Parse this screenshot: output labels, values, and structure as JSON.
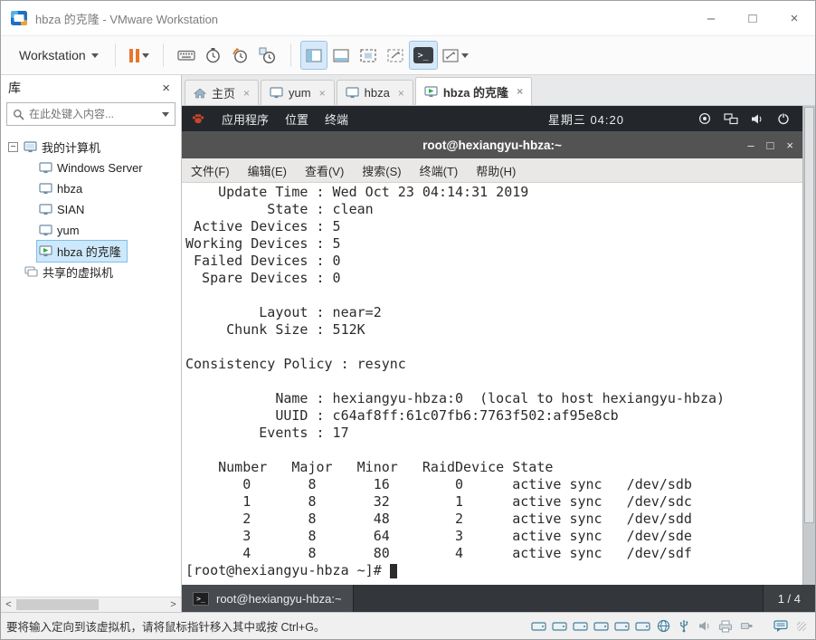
{
  "window": {
    "title": "hbza 的克隆 - VMware Workstation",
    "controls": {
      "minimize": "–",
      "maximize": "□",
      "close": "×"
    }
  },
  "toolbar": {
    "workstation_label": "Workstation"
  },
  "icons": {
    "tab_close": "×",
    "panel_close": "×",
    "expander_collapsed": "−",
    "scroll_left": "<",
    "scroll_right": ">",
    "console_glyph": ">_",
    "statusbar_devices": [
      "hard-disk",
      "hard-disk",
      "hard-disk",
      "hard-disk",
      "hard-disk",
      "hard-disk",
      "network",
      "usb-controller",
      "sound-card",
      "printer",
      "usb-device",
      "message-log"
    ]
  },
  "library": {
    "header": "库",
    "search_placeholder": "在此处键入内容...",
    "tree": {
      "root": "我的计算机",
      "items": [
        "Windows Server",
        "hbza",
        "SIAN",
        "yum",
        "hbza 的克隆"
      ],
      "shared": "共享的虚拟机"
    }
  },
  "tabs": [
    {
      "label": "主页"
    },
    {
      "label": "yum"
    },
    {
      "label": "hbza"
    },
    {
      "label": "hbza 的克隆"
    }
  ],
  "vm": {
    "topbar": {
      "menus": [
        "应用程序",
        "位置",
        "终端"
      ],
      "clock": "星期三 04:20"
    },
    "terminal": {
      "title": "root@hexiangyu-hbza:~",
      "menus": [
        "文件(F)",
        "编辑(E)",
        "查看(V)",
        "搜索(S)",
        "终端(T)",
        "帮助(H)"
      ],
      "controls": {
        "minimize": "–",
        "maximize": "□",
        "close": "×"
      },
      "lines": [
        "    Update Time : Wed Oct 23 04:14:31 2019",
        "          State : clean",
        " Active Devices : 5",
        "Working Devices : 5",
        " Failed Devices : 0",
        "  Spare Devices : 0",
        "",
        "         Layout : near=2",
        "     Chunk Size : 512K",
        "",
        "Consistency Policy : resync",
        "",
        "           Name : hexiangyu-hbza:0  (local to host hexiangyu-hbza)",
        "           UUID : c64af8ff:61c07fb6:7763f502:af95e8cb",
        "         Events : 17",
        "",
        "    Number   Major   Minor   RaidDevice State",
        "       0       8       16        0      active sync   /dev/sdb",
        "       1       8       32        1      active sync   /dev/sdc",
        "       2       8       48        2      active sync   /dev/sdd",
        "       3       8       64        3      active sync   /dev/sde",
        "       4       8       80        4      active sync   /dev/sdf"
      ],
      "prompt": "[root@hexiangyu-hbza ~]# "
    },
    "taskbar": {
      "task": "root@hexiangyu-hbza:~",
      "workspace": "1 / 4"
    }
  },
  "statusbar": {
    "message": "要将输入定向到该虚拟机，请将鼠标指针移入其中或按 Ctrl+G。"
  }
}
